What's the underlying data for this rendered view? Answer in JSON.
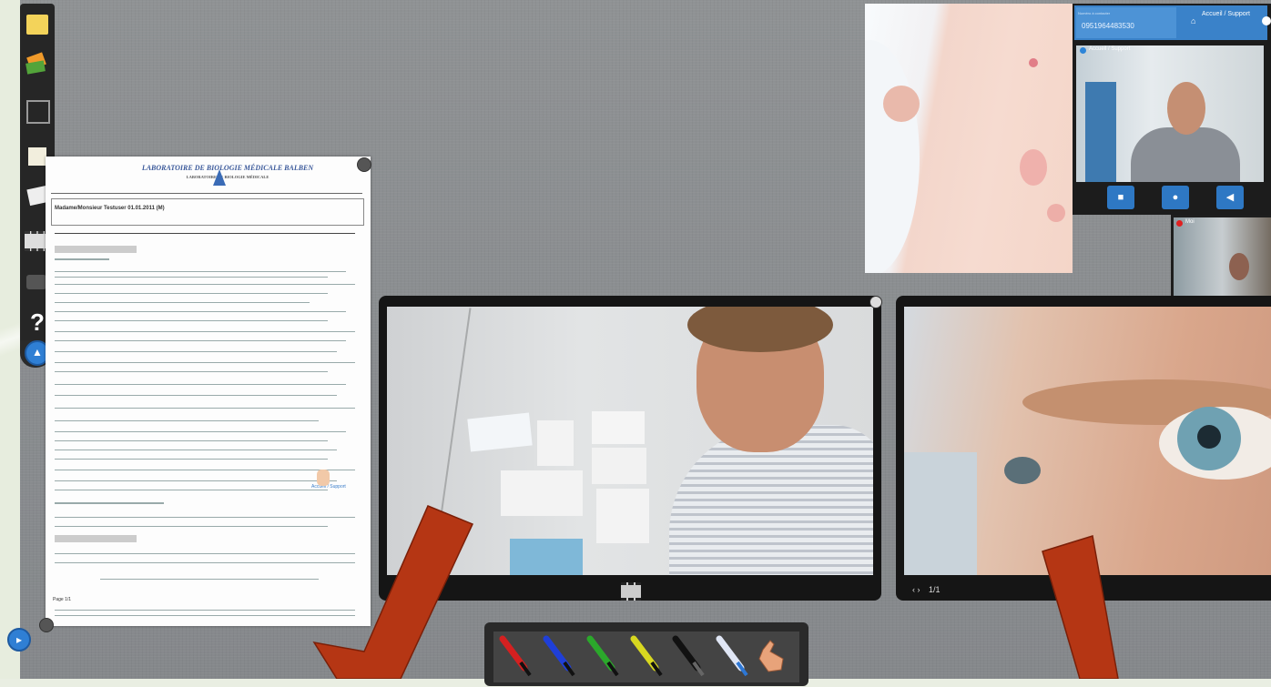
{
  "toolbar": {
    "items": [
      {
        "icon": "sticky-note-icon"
      },
      {
        "icon": "image-stack-icon"
      },
      {
        "icon": "blank-frame-icon"
      },
      {
        "icon": "document-icon"
      },
      {
        "icon": "document-page-icon"
      },
      {
        "icon": "video-reel-icon"
      },
      {
        "icon": "camera-icon"
      },
      {
        "icon": "help-icon",
        "glyph": "?"
      }
    ]
  },
  "call": {
    "number_small_label": "Numéro à contacter",
    "number": "0951964483530",
    "support_label": "Accueil / Support",
    "video_label": "Accueil / Support",
    "self_label": "Moi",
    "controls": [
      {
        "icon": "video-camera-icon",
        "glyph": "■"
      },
      {
        "icon": "microphone-icon",
        "glyph": "●"
      },
      {
        "icon": "speaker-icon",
        "glyph": "◀"
      }
    ]
  },
  "document": {
    "title_line1": "LABORATOIRE DE BIOLOGIE MÉDICALE BALBEN",
    "title_line2": "LABORATOIRE DE BIOLOGIE MÉDICALE",
    "patient_line": "Madame/Monsieur Testuser 01.01.2011 (M)",
    "footer": "Page 1/1",
    "watermark": "Accueil / Support"
  },
  "video_main": {
    "toolbar_icon": "film-strip-icon"
  },
  "video_right": {
    "pager": "1/1"
  },
  "pens": [
    {
      "color": "#d42020",
      "icon": "red-pen-icon"
    },
    {
      "color": "#1f3fd8",
      "icon": "blue-pen-icon"
    },
    {
      "color": "#2ba82b",
      "icon": "green-pen-icon"
    },
    {
      "color": "#d8d820",
      "icon": "yellow-pen-icon"
    },
    {
      "color": "#111111",
      "icon": "black-pen-icon"
    },
    {
      "color": "#e0e6f5",
      "icon": "eraser-pen-icon"
    },
    {
      "color": "#e8a37a",
      "icon": "hand-pointer-icon"
    }
  ],
  "annotation_arrow_color": "#b53614"
}
